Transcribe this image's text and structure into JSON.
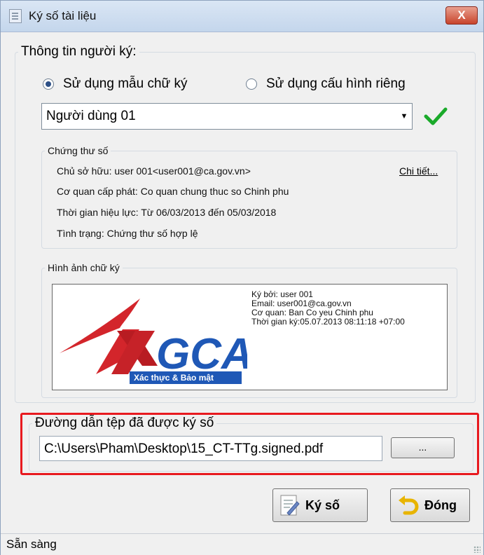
{
  "window": {
    "title": "Ký số tài liệu",
    "close_label": "X"
  },
  "signer": {
    "legend": "Thông tin người ký:",
    "options": [
      {
        "label": "Sử dụng mẫu chữ ký",
        "selected": true
      },
      {
        "label": "Sử dụng cấu hình riêng",
        "selected": false
      }
    ],
    "profile_value": "Người dùng 01",
    "profile_icon": "check-icon"
  },
  "certificate": {
    "legend": "Chứng thư số",
    "owner": "Chủ sở hữu: user 001<user001@ca.gov.vn>",
    "issuer": "Cơ quan cấp phát: Co quan chung thuc so Chinh phu",
    "validity": "Thời gian hiệu lực: Từ 06/03/2013 đến 05/03/2018",
    "status": "Tình trạng: Chứng thư số hợp lệ",
    "details_link": "Chi tiết..."
  },
  "signature_image": {
    "legend": "Hình ảnh chữ ký",
    "logo_text": "GCA",
    "logo_tagline": "Xác thực & Bảo mật",
    "signed_by": "Ký bởi: user 001",
    "email": "Email: user001@ca.gov.vn",
    "agency": "Cơ quan: Ban Co yeu Chinh phu",
    "time": "Thời gian ký:05.07.2013 08:11:18 +07:00"
  },
  "output": {
    "legend": "Đường dẫn tệp đã được ký số",
    "path_value": "C:\\Users\\Pham\\Desktop\\15_CT-TTg.signed.pdf",
    "browse_label": "..."
  },
  "buttons": {
    "sign_label": "Ký số",
    "close_label": "Đóng"
  },
  "status": {
    "text": "Sẵn sàng"
  },
  "colors": {
    "highlight": "#e8191f",
    "check": "#1aaa2a"
  }
}
